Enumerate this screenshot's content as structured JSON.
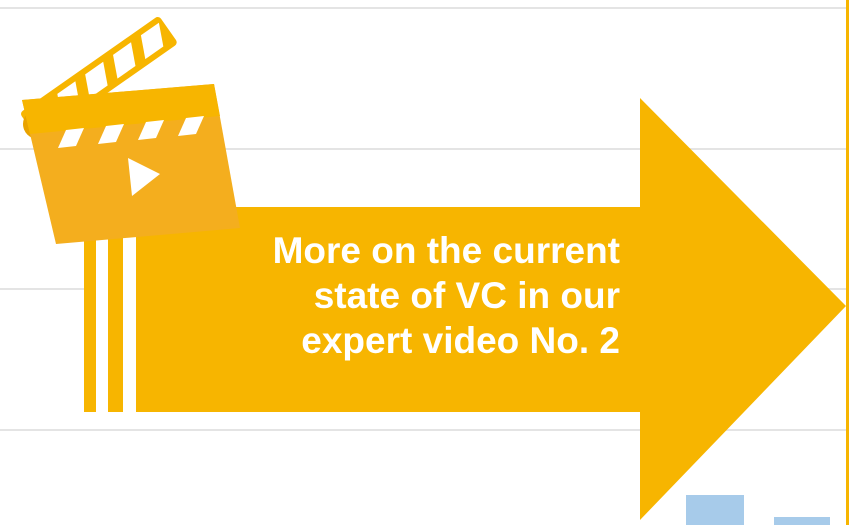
{
  "colors": {
    "accent": "#F7B500",
    "accent_dark": "#E9A300",
    "slate_face": "#F4AE1E",
    "slate_highlight": "#FFCF5A",
    "text": "#FFFFFF",
    "gridline": "#E4E4E4",
    "chart_bar": "#A7CBEA"
  },
  "icons": {
    "slate": "film-clapperboard-icon",
    "play": "play-icon",
    "arrow": "arrow-right-icon"
  },
  "callout": {
    "line1": "More on the current",
    "line2": "state of VC in our",
    "line3": "expert video No. 2"
  }
}
